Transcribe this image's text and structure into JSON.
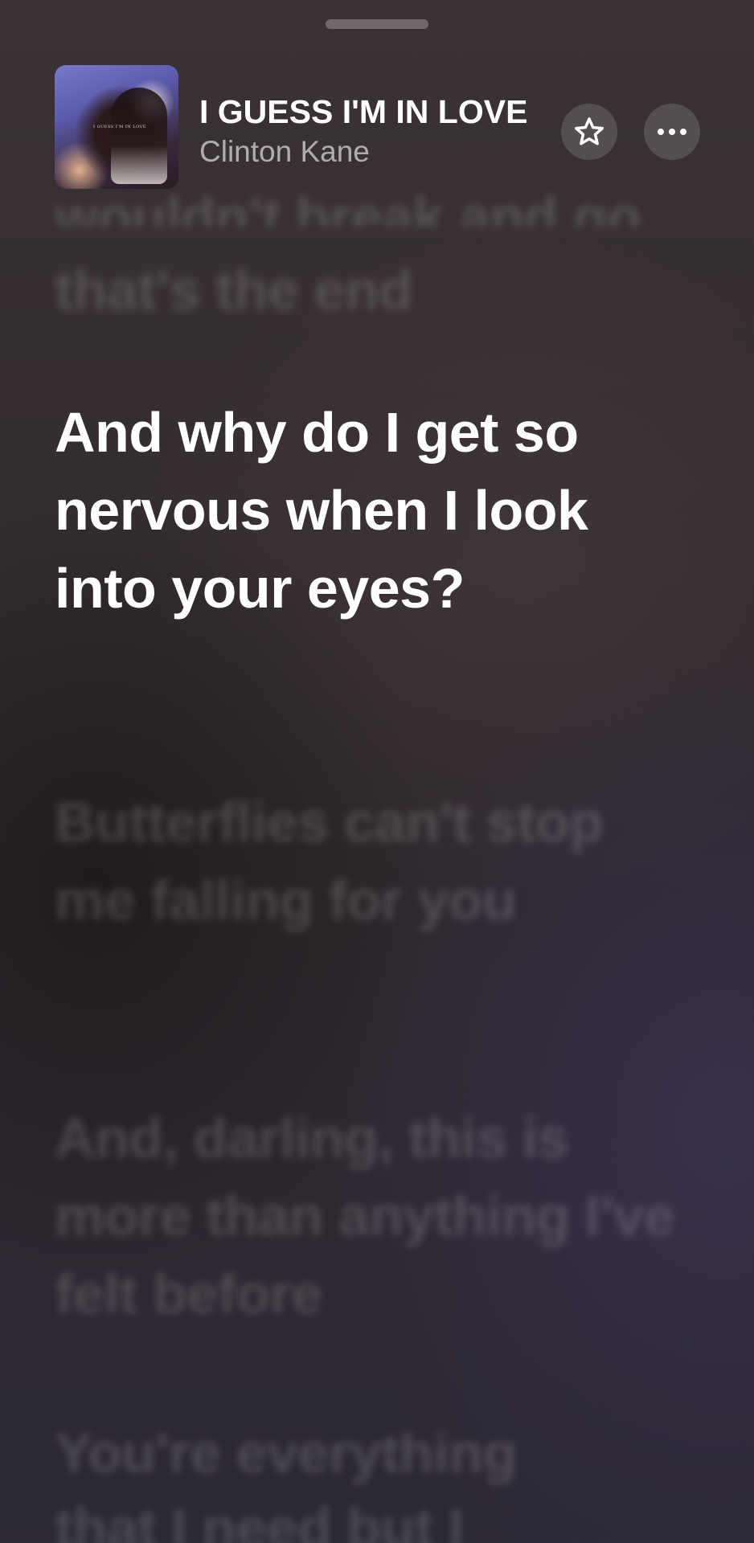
{
  "player": {
    "song_title": "I GUESS I'M IN LOVE",
    "artist": "Clinton Kane",
    "artwork_text": "I GUESS I'M IN LOVE",
    "favorite_icon": "star-icon",
    "more_icon": "ellipsis-icon"
  },
  "lyrics": {
    "prev_partial": "wouldn't break and go away",
    "prev": "that's the end",
    "current": "And why do I get so nervous when I look into your eyes?",
    "next_1": "Butterflies can't stop me falling for you",
    "next_2": "And, darling, this is more than anything I've felt before",
    "next_3": "You're everything",
    "next_4": "that I need but I"
  },
  "colors": {
    "background": "#332c30",
    "active_lyric": "#ffffff",
    "inactive_lyric": "rgba(255,255,255,0.16)"
  }
}
